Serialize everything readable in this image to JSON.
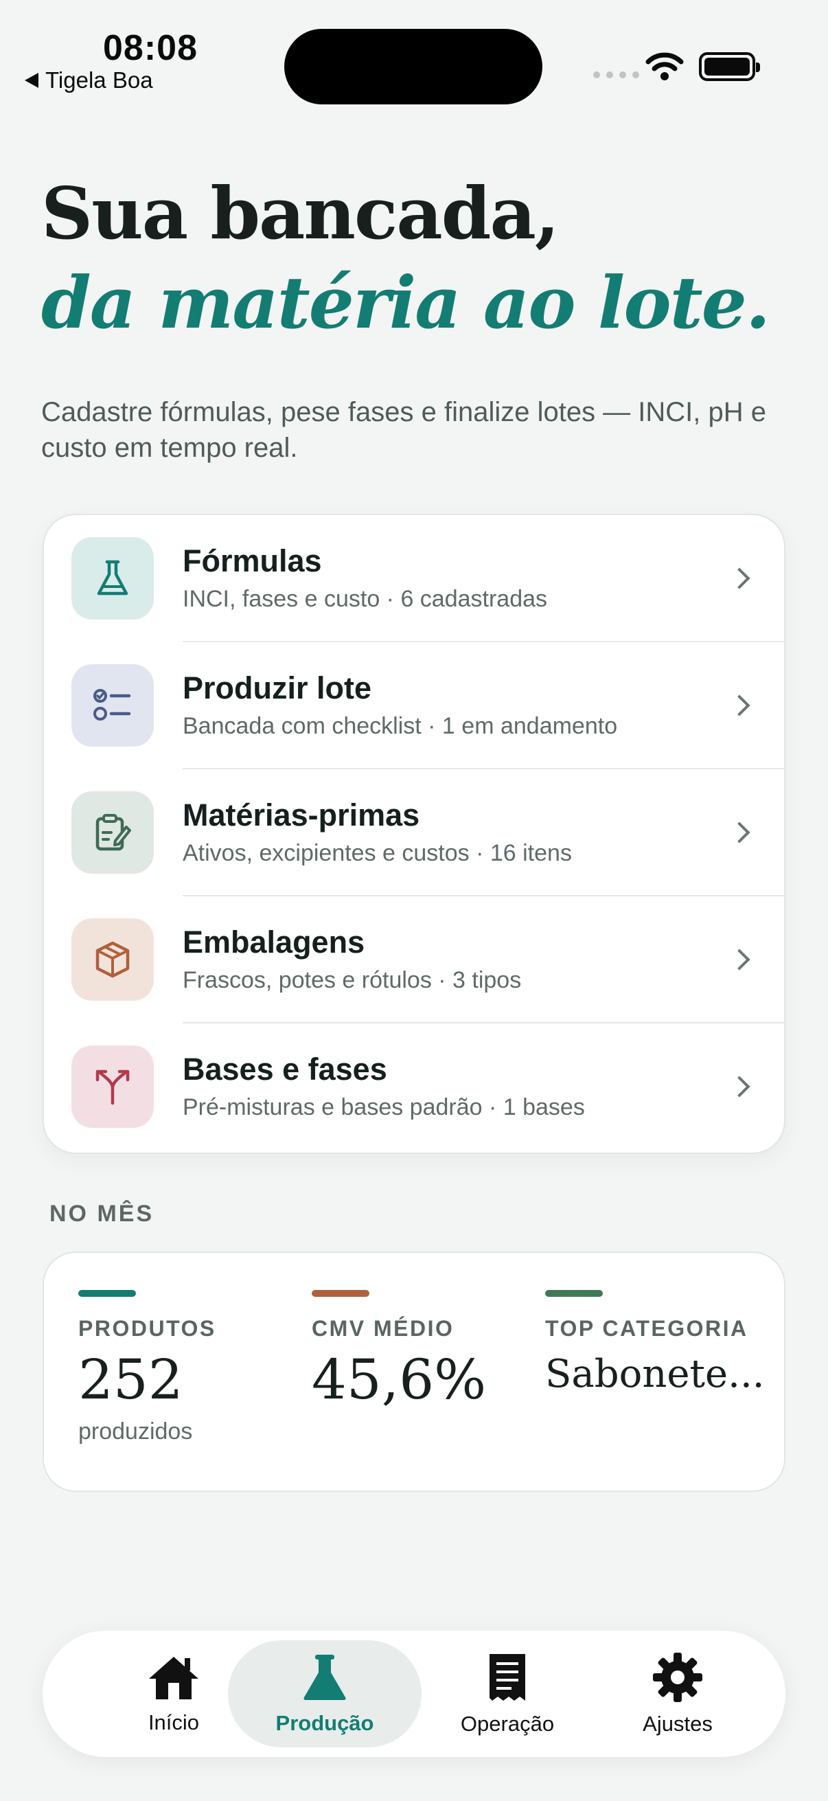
{
  "status_bar": {
    "time": "08:08",
    "back_app": "Tigela Boa"
  },
  "hero": {
    "title_line1": "Sua bancada,",
    "title_line2": "da matéria ao lote.",
    "subtitle": "Cadastre fórmulas, pese fases e finalize lotes — INCI, pH e custo em tempo real."
  },
  "menu": {
    "items": [
      {
        "title": "Fórmulas",
        "subtitle": "INCI, fases e custo · 6 cadastradas",
        "icon": "flask-icon",
        "tile_color": "#d9ecea",
        "icon_color": "#137d73"
      },
      {
        "title": "Produzir lote",
        "subtitle": "Bancada com checklist · 1 em andamento",
        "icon": "checklist-icon",
        "tile_color": "#e1e5ef",
        "icon_color": "#4a5a8a"
      },
      {
        "title": "Matérias-primas",
        "subtitle": "Ativos, excipientes e custos · 16 itens",
        "icon": "clipboard-edit-icon",
        "tile_color": "#dfe8e3",
        "icon_color": "#3f6b55"
      },
      {
        "title": "Embalagens",
        "subtitle": "Frascos, potes e rótulos · 3 tipos",
        "icon": "package-icon",
        "tile_color": "#f2e3da",
        "icon_color": "#b0603c"
      },
      {
        "title": "Bases e fases",
        "subtitle": "Pré-misturas e bases padrão · 1 bases",
        "icon": "split-icon",
        "tile_color": "#f3dfe3",
        "icon_color": "#b23a4e"
      }
    ]
  },
  "month": {
    "section_label": "NO MÊS",
    "stats": [
      {
        "label": "PRODUTOS",
        "value": "252",
        "caption": "produzidos",
        "color": "#137d73"
      },
      {
        "label": "CMV MÉDIO",
        "value": "45,6%",
        "caption": "",
        "color": "#b0603c"
      },
      {
        "label": "TOP CATEGORIA",
        "value": "Sabonete...",
        "caption": "",
        "color": "#3f7a55"
      }
    ]
  },
  "tab_bar": {
    "tabs": [
      {
        "label": "Início",
        "icon": "home-icon",
        "active": false
      },
      {
        "label": "Produção",
        "icon": "flask-icon",
        "active": true
      },
      {
        "label": "Operação",
        "icon": "receipt-icon",
        "active": false
      },
      {
        "label": "Ajustes",
        "icon": "gear-icon",
        "active": false
      }
    ]
  }
}
